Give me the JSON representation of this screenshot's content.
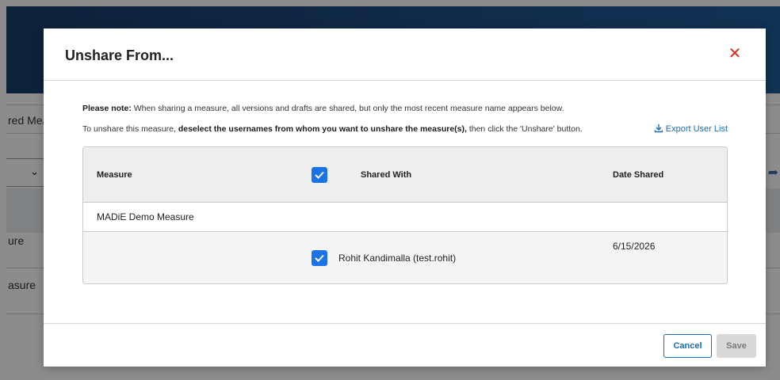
{
  "background": {
    "tab_fragment": "red Mea",
    "row_fragment_1": "ure",
    "row_fragment_2": "asure"
  },
  "modal": {
    "title": "Unshare From...",
    "note_label": "Please note:",
    "note_text": " When sharing a measure, all versions and drafts are shared, but only the most recent measure name appears below.",
    "instruction_prefix": "To unshare this measure, ",
    "instruction_bold": "deselect the usernames from whom you want to unshare the measure(s),",
    "instruction_suffix": " then click the 'Unshare' button.",
    "export_label": "Export User List",
    "table": {
      "headers": {
        "measure": "Measure",
        "shared_with": "Shared With",
        "date_shared": "Date Shared"
      },
      "header_checkbox_checked": true,
      "measure_name": "MADiE Demo Measure",
      "rows": [
        {
          "user": "Rohit Kandimalla (test.rohit)",
          "date": "6/15/2026",
          "checked": true
        }
      ]
    },
    "buttons": {
      "cancel": "Cancel",
      "save": "Save"
    }
  },
  "colors": {
    "accent": "#1a73e8",
    "link": "#1a6bb5",
    "close": "#d62d20",
    "header_bg": "#1e4f86"
  }
}
